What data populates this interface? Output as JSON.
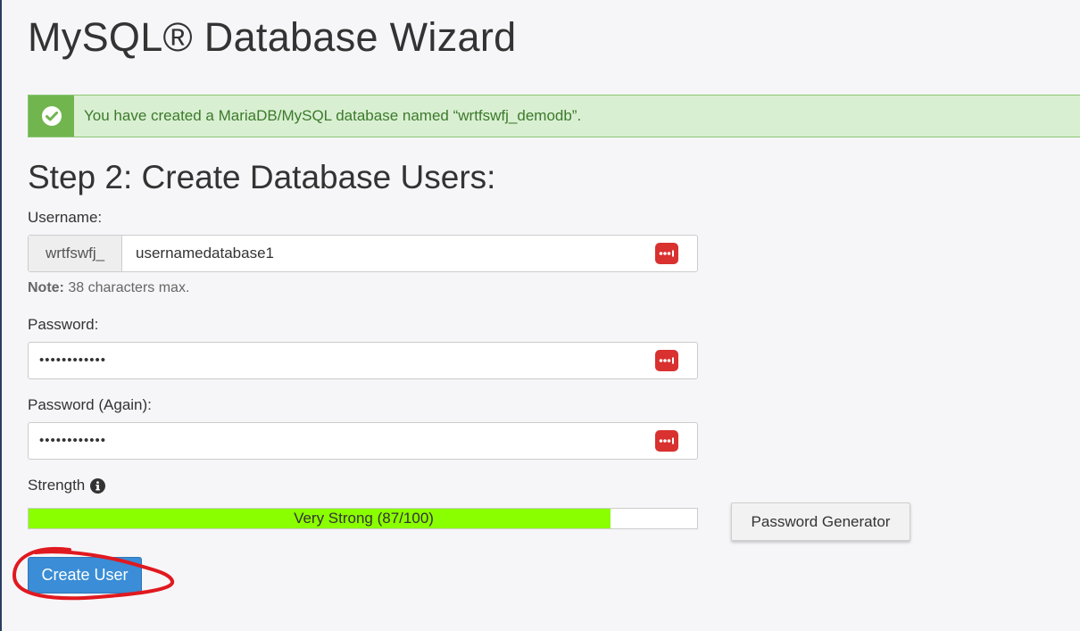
{
  "page": {
    "title": "MySQL® Database Wizard"
  },
  "alert": {
    "message": "You have created a MariaDB/MySQL database named “wrtfswfj_demodb”.",
    "icon": "check-circle-icon",
    "color": "#71b54f"
  },
  "step": {
    "title": "Step 2: Create Database Users:"
  },
  "form": {
    "username_label": "Username:",
    "username_prefix": "wrtfswfj_",
    "username_value": "usernamedatabase1",
    "note_bold": "Note:",
    "note_text": " 38 characters max.",
    "password_label": "Password:",
    "password_value": "••••••••••••",
    "password_again_label": "Password (Again):",
    "password_again_value": "••••••••••••",
    "password_manager_icon": "password-manager-icon",
    "password_manager_color": "#d8312f"
  },
  "strength": {
    "label": "Strength",
    "info_icon": "info-icon",
    "text": "Very Strong (87/100)",
    "score": 87,
    "max": 100,
    "bar_fill_fraction": 0.87,
    "bar_color": "#8aff00"
  },
  "buttons": {
    "password_generator": "Password Generator",
    "create_user": "Create User",
    "create_user_color": "#3a8dd6"
  },
  "annotation": {
    "color": "#e0191f"
  }
}
